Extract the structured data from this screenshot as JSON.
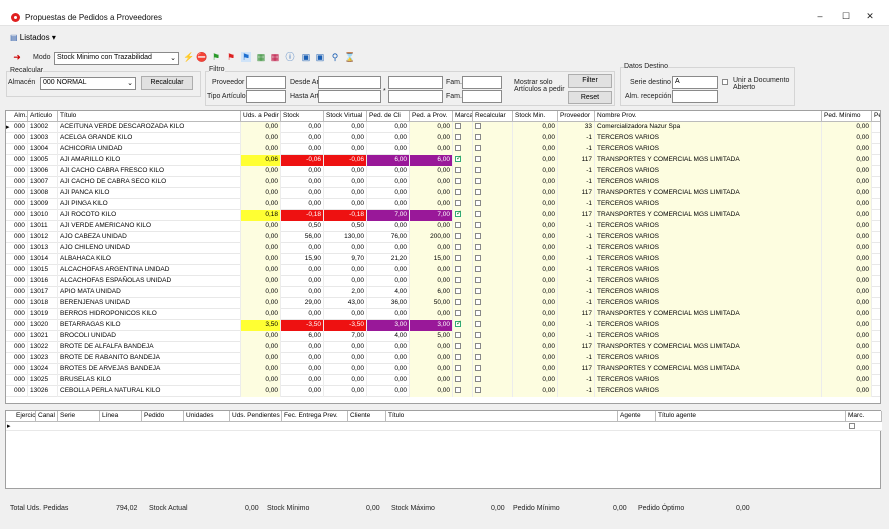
{
  "window": {
    "title": "Propuestas de Pedidos a Proveedores",
    "minimize": "‒",
    "maximize": "☐",
    "close": "✕"
  },
  "menu": {
    "listados": "Listados"
  },
  "toolbar": {
    "modo_label": "Modo",
    "modo_value": "Stock Minimo con Trazabilidad"
  },
  "recalcular": {
    "group": "Recalcular",
    "almacen_label": "Almacén",
    "almacen_value": "000 NORMAL",
    "button": "Recalcular"
  },
  "filtro": {
    "group": "Filtro",
    "proveedor": "Proveedor",
    "tipo_articulo": "Tipo Artículo",
    "desde_art": "Desde Art.",
    "hasta_art": "Hasta Art.",
    "fam1": "Fam.",
    "fam2": "Fam.",
    "asterisk": "*",
    "mostrar": "Mostrar solo Artículos a pedir",
    "filter": "Filter",
    "reset": "Reset"
  },
  "destino": {
    "group": "Datos Destino",
    "serie_label": "Serie destino",
    "serie_value": "A",
    "alm_label": "Alm. recepción",
    "unir": "Unir a Documento Abierto"
  },
  "grid": {
    "headers": [
      "Alm.",
      "Artículo",
      "Título",
      "Uds. a Pedir",
      "Stock",
      "Stock Virtual",
      "Ped. de Cli",
      "Ped. a Prov.",
      "Marca",
      "Recalcular",
      "Stock Min.",
      "Proveedor",
      "Nombre Prov.",
      "Ped. Mínimo",
      "Pe"
    ],
    "rows": [
      {
        "alm": "000",
        "art": "13002",
        "tit": "ACEITUNA VERDE DESCAROZADA KILO",
        "uds": "0,00",
        "stock": "0,00",
        "sv": "0,00",
        "pcli": "0,00",
        "pprov": "0,00",
        "marca": false,
        "smin": "0,00",
        "prov": "33",
        "nom": "Comercializadora Nazur Spa",
        "pmin": "0,00",
        "hl": ""
      },
      {
        "alm": "000",
        "art": "13003",
        "tit": "ACELGA GRANDE KILO",
        "uds": "0,00",
        "stock": "0,00",
        "sv": "0,00",
        "pcli": "0,00",
        "pprov": "0,00",
        "marca": false,
        "smin": "0,00",
        "prov": "-1",
        "nom": "TERCEROS VARIOS",
        "pmin": "0,00",
        "hl": ""
      },
      {
        "alm": "000",
        "art": "13004",
        "tit": "ACHICORIA UNIDAD",
        "uds": "0,00",
        "stock": "0,00",
        "sv": "0,00",
        "pcli": "0,00",
        "pprov": "0,00",
        "marca": false,
        "smin": "0,00",
        "prov": "-1",
        "nom": "TERCEROS VARIOS",
        "pmin": "0,00",
        "hl": ""
      },
      {
        "alm": "000",
        "art": "13005",
        "tit": "AJI AMARILLO KILO",
        "uds": "0,06",
        "stock": "-0,06",
        "sv": "-0,06",
        "pcli": "6,00",
        "pprov": "6,00",
        "marca": true,
        "smin": "0,00",
        "prov": "117",
        "nom": "TRANSPORTES Y COMERCIAL MGS LIMITADA",
        "pmin": "0,00",
        "hl": "1"
      },
      {
        "alm": "000",
        "art": "13006",
        "tit": "AJI CACHO CABRA FRESCO KILO",
        "uds": "0,00",
        "stock": "0,00",
        "sv": "0,00",
        "pcli": "0,00",
        "pprov": "0,00",
        "marca": false,
        "smin": "0,00",
        "prov": "-1",
        "nom": "TERCEROS VARIOS",
        "pmin": "0,00",
        "hl": ""
      },
      {
        "alm": "000",
        "art": "13007",
        "tit": "AJI CACHO DE CABRA SECO KILO",
        "uds": "0,00",
        "stock": "0,00",
        "sv": "0,00",
        "pcli": "0,00",
        "pprov": "0,00",
        "marca": false,
        "smin": "0,00",
        "prov": "-1",
        "nom": "TERCEROS VARIOS",
        "pmin": "0,00",
        "hl": ""
      },
      {
        "alm": "000",
        "art": "13008",
        "tit": "AJI PANCA KILO",
        "uds": "0,00",
        "stock": "0,00",
        "sv": "0,00",
        "pcli": "0,00",
        "pprov": "0,00",
        "marca": false,
        "smin": "0,00",
        "prov": "117",
        "nom": "TRANSPORTES Y COMERCIAL MGS LIMITADA",
        "pmin": "0,00",
        "hl": ""
      },
      {
        "alm": "000",
        "art": "13009",
        "tit": "AJI PINGA KILO",
        "uds": "0,00",
        "stock": "0,00",
        "sv": "0,00",
        "pcli": "0,00",
        "pprov": "0,00",
        "marca": false,
        "smin": "0,00",
        "prov": "-1",
        "nom": "TERCEROS VARIOS",
        "pmin": "0,00",
        "hl": ""
      },
      {
        "alm": "000",
        "art": "13010",
        "tit": "AJI ROCOTO KILO",
        "uds": "0,18",
        "stock": "-0,18",
        "sv": "-0,18",
        "pcli": "7,00",
        "pprov": "7,00",
        "marca": true,
        "smin": "0,00",
        "prov": "117",
        "nom": "TRANSPORTES Y COMERCIAL MGS LIMITADA",
        "pmin": "0,00",
        "hl": "1"
      },
      {
        "alm": "000",
        "art": "13011",
        "tit": "AJI VERDE AMERICANO KILO",
        "uds": "0,00",
        "stock": "0,50",
        "sv": "0,50",
        "pcli": "0,00",
        "pprov": "0,00",
        "marca": false,
        "smin": "0,00",
        "prov": "-1",
        "nom": "TERCEROS VARIOS",
        "pmin": "0,00",
        "hl": ""
      },
      {
        "alm": "000",
        "art": "13012",
        "tit": "AJO CABEZA UNIDAD",
        "uds": "0,00",
        "stock": "56,00",
        "sv": "130,00",
        "pcli": "76,00",
        "pprov": "200,00",
        "marca": false,
        "smin": "0,00",
        "prov": "-1",
        "nom": "TERCEROS VARIOS",
        "pmin": "0,00",
        "hl": ""
      },
      {
        "alm": "000",
        "art": "13013",
        "tit": "AJO CHILENO UNIDAD",
        "uds": "0,00",
        "stock": "0,00",
        "sv": "0,00",
        "pcli": "0,00",
        "pprov": "0,00",
        "marca": false,
        "smin": "0,00",
        "prov": "-1",
        "nom": "TERCEROS VARIOS",
        "pmin": "0,00",
        "hl": ""
      },
      {
        "alm": "000",
        "art": "13014",
        "tit": "ALBAHACA KILO",
        "uds": "0,00",
        "stock": "15,90",
        "sv": "9,70",
        "pcli": "21,20",
        "pprov": "15,00",
        "marca": false,
        "smin": "0,00",
        "prov": "-1",
        "nom": "TERCEROS VARIOS",
        "pmin": "0,00",
        "hl": ""
      },
      {
        "alm": "000",
        "art": "13015",
        "tit": "ALCACHOFAS ARGENTINA UNIDAD",
        "uds": "0,00",
        "stock": "0,00",
        "sv": "0,00",
        "pcli": "0,00",
        "pprov": "0,00",
        "marca": false,
        "smin": "0,00",
        "prov": "-1",
        "nom": "TERCEROS VARIOS",
        "pmin": "0,00",
        "hl": ""
      },
      {
        "alm": "000",
        "art": "13016",
        "tit": "ALCACHOFAS ESPAÑOLAS UNIDAD",
        "uds": "0,00",
        "stock": "0,00",
        "sv": "0,00",
        "pcli": "0,00",
        "pprov": "0,00",
        "marca": false,
        "smin": "0,00",
        "prov": "-1",
        "nom": "TERCEROS VARIOS",
        "pmin": "0,00",
        "hl": ""
      },
      {
        "alm": "000",
        "art": "13017",
        "tit": "APIO MATA UNIDAD",
        "uds": "0,00",
        "stock": "0,00",
        "sv": "2,00",
        "pcli": "4,00",
        "pprov": "6,00",
        "marca": false,
        "smin": "0,00",
        "prov": "-1",
        "nom": "TERCEROS VARIOS",
        "pmin": "0,00",
        "hl": ""
      },
      {
        "alm": "000",
        "art": "13018",
        "tit": "BERENJENAS UNIDAD",
        "uds": "0,00",
        "stock": "29,00",
        "sv": "43,00",
        "pcli": "36,00",
        "pprov": "50,00",
        "marca": false,
        "smin": "0,00",
        "prov": "-1",
        "nom": "TERCEROS VARIOS",
        "pmin": "0,00",
        "hl": ""
      },
      {
        "alm": "000",
        "art": "13019",
        "tit": "BERROS HIDROPONICOS KILO",
        "uds": "0,00",
        "stock": "0,00",
        "sv": "0,00",
        "pcli": "0,00",
        "pprov": "0,00",
        "marca": false,
        "smin": "0,00",
        "prov": "117",
        "nom": "TRANSPORTES Y COMERCIAL MGS LIMITADA",
        "pmin": "0,00",
        "hl": ""
      },
      {
        "alm": "000",
        "art": "13020",
        "tit": "BETARRAGAS KILO",
        "uds": "3,50",
        "stock": "-3,50",
        "sv": "-3,50",
        "pcli": "3,00",
        "pprov": "3,00",
        "marca": true,
        "smin": "0,00",
        "prov": "-1",
        "nom": "TERCEROS VARIOS",
        "pmin": "0,00",
        "hl": "1"
      },
      {
        "alm": "000",
        "art": "13021",
        "tit": "BROCOLI UNIDAD",
        "uds": "0,00",
        "stock": "6,00",
        "sv": "7,00",
        "pcli": "4,00",
        "pprov": "5,00",
        "marca": false,
        "smin": "0,00",
        "prov": "-1",
        "nom": "TERCEROS VARIOS",
        "pmin": "0,00",
        "hl": ""
      },
      {
        "alm": "000",
        "art": "13022",
        "tit": "BROTE DE ALFALFA BANDEJA",
        "uds": "0,00",
        "stock": "0,00",
        "sv": "0,00",
        "pcli": "0,00",
        "pprov": "0,00",
        "marca": false,
        "smin": "0,00",
        "prov": "117",
        "nom": "TRANSPORTES Y COMERCIAL MGS LIMITADA",
        "pmin": "0,00",
        "hl": ""
      },
      {
        "alm": "000",
        "art": "13023",
        "tit": "BROTE DE RABANITO BANDEJA",
        "uds": "0,00",
        "stock": "0,00",
        "sv": "0,00",
        "pcli": "0,00",
        "pprov": "0,00",
        "marca": false,
        "smin": "0,00",
        "prov": "-1",
        "nom": "TERCEROS VARIOS",
        "pmin": "0,00",
        "hl": ""
      },
      {
        "alm": "000",
        "art": "13024",
        "tit": "BROTES DE ARVEJAS BANDEJA",
        "uds": "0,00",
        "stock": "0,00",
        "sv": "0,00",
        "pcli": "0,00",
        "pprov": "0,00",
        "marca": false,
        "smin": "0,00",
        "prov": "117",
        "nom": "TRANSPORTES Y COMERCIAL MGS LIMITADA",
        "pmin": "0,00",
        "hl": ""
      },
      {
        "alm": "000",
        "art": "13025",
        "tit": "BRUSELAS KILO",
        "uds": "0,00",
        "stock": "0,00",
        "sv": "0,00",
        "pcli": "0,00",
        "pprov": "0,00",
        "marca": false,
        "smin": "0,00",
        "prov": "-1",
        "nom": "TERCEROS VARIOS",
        "pmin": "0,00",
        "hl": ""
      },
      {
        "alm": "000",
        "art": "13026",
        "tit": "CEBOLLA PERLA NATURAL KILO",
        "uds": "0,00",
        "stock": "0,00",
        "sv": "0,00",
        "pcli": "0,00",
        "pprov": "0,00",
        "marca": false,
        "smin": "0,00",
        "prov": "-1",
        "nom": "TERCEROS VARIOS",
        "pmin": "0,00",
        "hl": ""
      }
    ]
  },
  "detail": {
    "headers": [
      "Ejercicio",
      "Canal",
      "Serie",
      "Línea",
      "Pedido",
      "Unidades",
      "Uds. Pendientes",
      "Fec. Entrega Prev.",
      "Cliente",
      "Título",
      "Agente",
      "Título agente",
      "Marc."
    ]
  },
  "footer": {
    "total_lbl": "Total Uds. Pedidas",
    "total_val": "794,02",
    "sa_lbl": "Stock Actual",
    "sa_val": "0,00",
    "smin_lbl": "Stock Mínimo",
    "smin_val": "0,00",
    "smax_lbl": "Stock Máximo",
    "smax_val": "0,00",
    "pmin_lbl": "Pedido Mínimo",
    "pmin_val": "0,00",
    "popt_lbl": "Pedido Óptimo",
    "popt_val": "0,00"
  },
  "colors": {
    "yellow": "#ffff33",
    "red": "#ee1111",
    "purple": "#991899"
  }
}
